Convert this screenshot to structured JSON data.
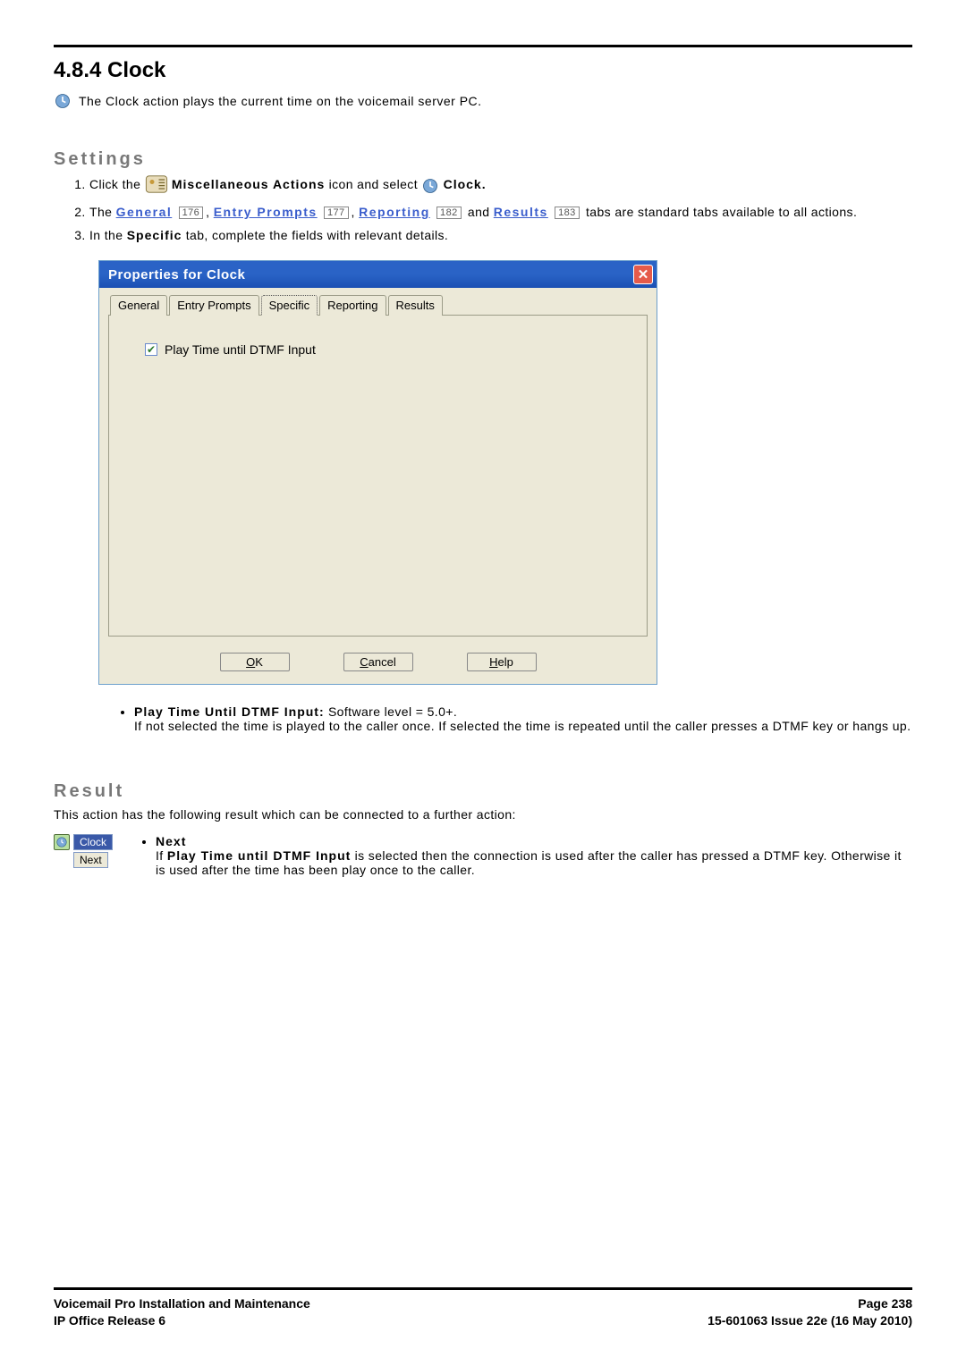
{
  "section": {
    "number_title": "4.8.4 Clock",
    "intro": " The Clock action plays the current time on the voicemail server PC."
  },
  "settings": {
    "heading": "Settings",
    "step1_pre": "Click the ",
    "misc_actions": "Miscellaneous Actions",
    "step1_mid": " icon and select ",
    "clock_label": " Clock.",
    "step2_pre": "The ",
    "links": {
      "general": "General",
      "general_pg": "176",
      "entry": "Entry Prompts",
      "entry_pg": "177",
      "reporting": "Reporting",
      "reporting_pg": "182",
      "results": "Results",
      "results_pg": "183"
    },
    "step2_post": " tabs are standard tabs available to all actions.",
    "step3_pre": "In the ",
    "specific_strong": "Specific",
    "step3_post": " tab, complete the fields with relevant details."
  },
  "dialog": {
    "title": "Properties for Clock",
    "tabs": [
      "General",
      "Entry Prompts",
      "Specific",
      "Reporting",
      "Results"
    ],
    "checkbox_label": "Play Time until DTMF Input",
    "buttons": {
      "ok": "OK",
      "cancel": "Cancel",
      "help": "Help"
    }
  },
  "bullets": {
    "b1_strong": "Play Time Until DTMF Input:",
    "b1_rest": " Software level = 5.0+.",
    "b2": "If not selected the time is played to the caller once. If selected the time is repeated until the caller presses a DTMF key or hangs up."
  },
  "result": {
    "heading": "Result",
    "desc": "This action has the following result which can be connected to a further action:",
    "flow": {
      "clock": "Clock",
      "next": "Next"
    },
    "next_label": "Next",
    "next_desc_pre": "If ",
    "next_desc_strong": "Play Time until DTMF Input",
    "next_desc_post": " is selected then the connection is used after the caller has pressed a DTMF key. Otherwise it is used after the time has been play once to the caller."
  },
  "footer": {
    "left1": "Voicemail Pro Installation and Maintenance",
    "left2": "IP Office Release 6",
    "right1": "Page 238",
    "right2": "15-601063 Issue 22e (16 May 2010)"
  }
}
